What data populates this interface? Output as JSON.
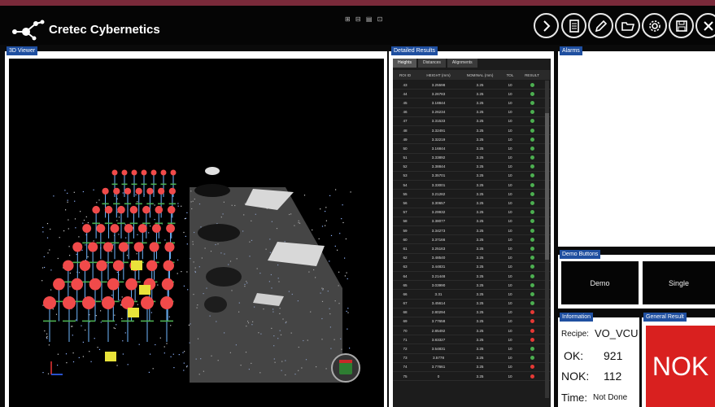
{
  "app": {
    "title": "Cretec Cybernetics",
    "mini_icons": "⊞ ⊟ ▤ ⊡"
  },
  "toolbar": {
    "buttons": [
      {
        "name": "next",
        "icon": "chevron-right-icon"
      },
      {
        "name": "document",
        "icon": "document-icon"
      },
      {
        "name": "edit",
        "icon": "pencil-icon"
      },
      {
        "name": "open",
        "icon": "folder-icon"
      },
      {
        "name": "settings",
        "icon": "gear-icon"
      },
      {
        "name": "save",
        "icon": "disk-icon"
      },
      {
        "name": "close",
        "icon": "close-icon"
      }
    ]
  },
  "panels": {
    "viewer": "3D Viewer",
    "results": "Detailed Results",
    "alarms": "Alarms",
    "demo": "Demo Buttons",
    "information": "Information",
    "general": "General Result"
  },
  "results": {
    "tabs": [
      "Heights",
      "Distances",
      "Alignments"
    ],
    "active_tab": "Heights",
    "columns": [
      "ROI ID",
      "HEIGHT (mm)",
      "NOMINAL (mm)",
      "TOL",
      "RESULT"
    ],
    "rows": [
      {
        "id": "43",
        "height": "3.25598",
        "nominal": "3.25",
        "tol": "10",
        "result": "ok"
      },
      {
        "id": "44",
        "height": "3.26783",
        "nominal": "3.25",
        "tol": "10",
        "result": "ok"
      },
      {
        "id": "45",
        "height": "3.18844",
        "nominal": "3.25",
        "tol": "10",
        "result": "ok"
      },
      {
        "id": "46",
        "height": "3.26234",
        "nominal": "3.25",
        "tol": "10",
        "result": "ok"
      },
      {
        "id": "47",
        "height": "3.31533",
        "nominal": "3.25",
        "tol": "10",
        "result": "ok"
      },
      {
        "id": "48",
        "height": "3.32491",
        "nominal": "3.25",
        "tol": "10",
        "result": "ok"
      },
      {
        "id": "49",
        "height": "3.32219",
        "nominal": "3.25",
        "tol": "10",
        "result": "ok"
      },
      {
        "id": "50",
        "height": "3.16844",
        "nominal": "3.25",
        "tol": "10",
        "result": "ok"
      },
      {
        "id": "51",
        "height": "3.33892",
        "nominal": "3.25",
        "tol": "10",
        "result": "ok"
      },
      {
        "id": "52",
        "height": "3.38844",
        "nominal": "3.25",
        "tol": "10",
        "result": "ok"
      },
      {
        "id": "53",
        "height": "3.35701",
        "nominal": "3.25",
        "tol": "10",
        "result": "ok"
      },
      {
        "id": "54",
        "height": "3.33001",
        "nominal": "3.25",
        "tol": "10",
        "result": "ok"
      },
      {
        "id": "55",
        "height": "3.21282",
        "nominal": "3.25",
        "tol": "10",
        "result": "ok"
      },
      {
        "id": "56",
        "height": "3.30657",
        "nominal": "3.25",
        "tol": "10",
        "result": "ok"
      },
      {
        "id": "57",
        "height": "3.29932",
        "nominal": "3.25",
        "tol": "10",
        "result": "ok"
      },
      {
        "id": "58",
        "height": "3.38077",
        "nominal": "3.25",
        "tol": "10",
        "result": "ok"
      },
      {
        "id": "59",
        "height": "3.34273",
        "nominal": "3.25",
        "tol": "10",
        "result": "ok"
      },
      {
        "id": "60",
        "height": "3.37166",
        "nominal": "3.25",
        "tol": "10",
        "result": "ok"
      },
      {
        "id": "61",
        "height": "3.25163",
        "nominal": "3.25",
        "tol": "10",
        "result": "ok"
      },
      {
        "id": "62",
        "height": "3.48540",
        "nominal": "3.25",
        "tol": "10",
        "result": "ok"
      },
      {
        "id": "63",
        "height": "3.44831",
        "nominal": "3.25",
        "tol": "10",
        "result": "ok"
      },
      {
        "id": "64",
        "height": "3.21448",
        "nominal": "3.25",
        "tol": "10",
        "result": "ok"
      },
      {
        "id": "65",
        "height": "3.03990",
        "nominal": "3.25",
        "tol": "10",
        "result": "ok"
      },
      {
        "id": "66",
        "height": "3.31",
        "nominal": "3.25",
        "tol": "10",
        "result": "ok"
      },
      {
        "id": "67",
        "height": "3.45614",
        "nominal": "3.25",
        "tol": "10",
        "result": "ok"
      },
      {
        "id": "68",
        "height": "2.80294",
        "nominal": "3.25",
        "tol": "10",
        "result": "nok"
      },
      {
        "id": "69",
        "height": "3.77658",
        "nominal": "3.25",
        "tol": "10",
        "result": "nok"
      },
      {
        "id": "70",
        "height": "2.85492",
        "nominal": "3.25",
        "tol": "10",
        "result": "nok"
      },
      {
        "id": "71",
        "height": "3.83327",
        "nominal": "3.25",
        "tol": "10",
        "result": "nok"
      },
      {
        "id": "72",
        "height": "3.54831",
        "nominal": "3.25",
        "tol": "10",
        "result": "ok"
      },
      {
        "id": "73",
        "height": "3.5778",
        "nominal": "3.25",
        "tol": "10",
        "result": "ok"
      },
      {
        "id": "74",
        "height": "3.77661",
        "nominal": "3.25",
        "tol": "10",
        "result": "nok"
      },
      {
        "id": "75",
        "height": "0",
        "nominal": "3.25",
        "tol": "10",
        "result": "nok"
      }
    ]
  },
  "demo_buttons": [
    "Demo",
    "Single"
  ],
  "information": {
    "recipe_label": "Recipe:",
    "recipe_value": "VO_VCU",
    "ok_label": "OK:",
    "ok_value": "921",
    "nok_label": "NOK:",
    "nok_value": "112",
    "time_label": "Time:",
    "time_value": "Not Done"
  },
  "general_result": "NOK",
  "colors": {
    "ok": "#4caf50",
    "nok": "#e53935",
    "tag": "#1f4fa0",
    "nok_box": "#d9201f"
  }
}
